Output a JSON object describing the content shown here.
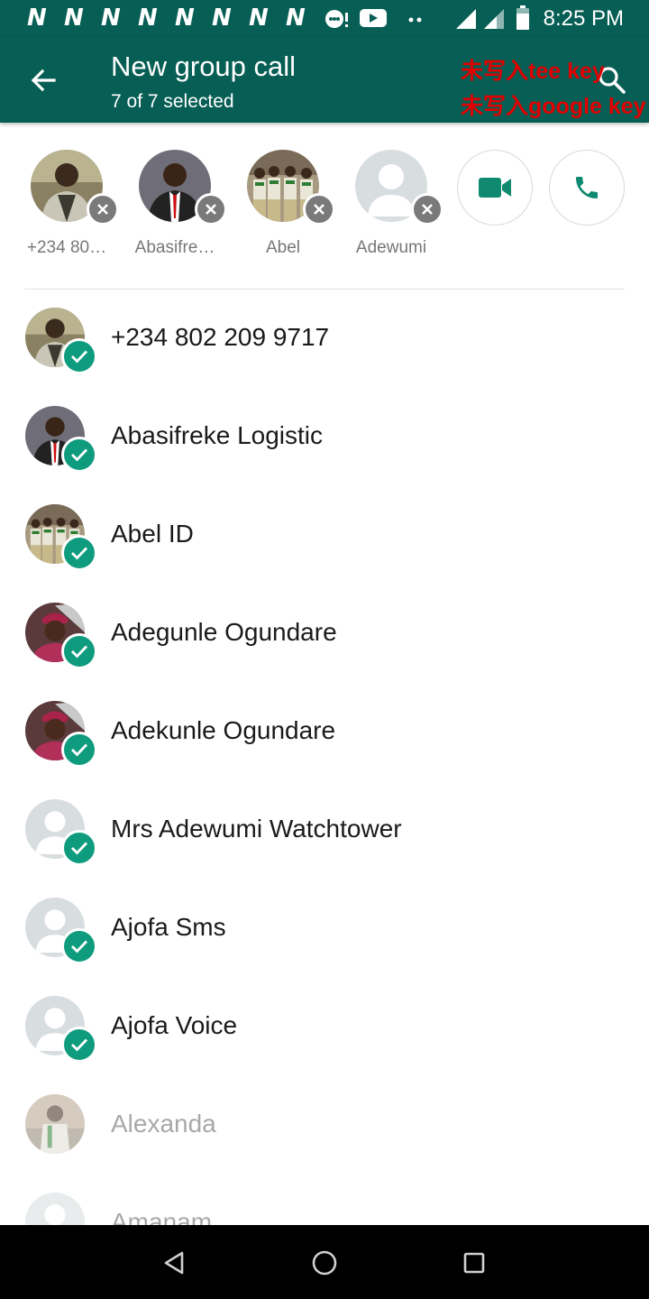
{
  "status_bar": {
    "time": "8:25 PM",
    "notification_letter": "N",
    "notification_count": 8
  },
  "toolbar": {
    "title": "New group call",
    "subtitle": "7 of 7 selected",
    "warning_line_1": "未写入tee key",
    "warning_line_2": "未写入google key"
  },
  "selected": [
    {
      "label": "+234 80…",
      "avatar": "photo-man-suit"
    },
    {
      "label": "Abasifre…",
      "avatar": "photo-man-red-tie"
    },
    {
      "label": "Abel",
      "avatar": "photo-group"
    },
    {
      "label": "Adewumi",
      "avatar": "default"
    }
  ],
  "contacts": [
    {
      "name": "+234 802 209 9717",
      "selected": true,
      "avatar": "photo-man-suit"
    },
    {
      "name": "Abasifreke Logistic",
      "selected": true,
      "avatar": "photo-man-red-tie"
    },
    {
      "name": "Abel ID",
      "selected": true,
      "avatar": "photo-group"
    },
    {
      "name": "Adegunle Ogundare",
      "selected": true,
      "avatar": "photo-man-cap"
    },
    {
      "name": "Adekunle Ogundare",
      "selected": true,
      "avatar": "photo-man-cap"
    },
    {
      "name": "Mrs Adewumi Watchtower",
      "selected": true,
      "avatar": "default"
    },
    {
      "name": "Ajofa Sms",
      "selected": true,
      "avatar": "default"
    },
    {
      "name": "Ajofa Voice",
      "selected": true,
      "avatar": "default"
    },
    {
      "name": "Alexanda",
      "selected": false,
      "avatar": "photo-man-outdoor"
    },
    {
      "name": "Amanam",
      "selected": false,
      "avatar": "default"
    }
  ],
  "icons": {
    "back": "arrow-left-icon",
    "search": "search-icon",
    "video_call": "video-camera-icon",
    "voice_call": "phone-icon",
    "nav_back": "triangle-back-icon",
    "nav_home": "circle-home-icon",
    "nav_recents": "square-recents-icon"
  },
  "colors": {
    "toolbar": "#075e54",
    "accent": "#0f9b7e",
    "warning": "#e00000"
  }
}
